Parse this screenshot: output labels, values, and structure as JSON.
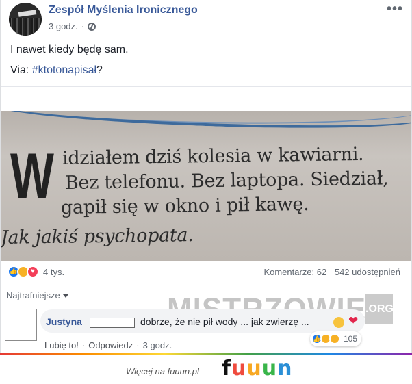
{
  "post": {
    "page_name": "Zespół Myślenia Ironicznego",
    "time": "3 godz.",
    "text_line1": "I nawet kiedy będę sam.",
    "via_label": "Via: ",
    "hashtag": "#ktotonapisał",
    "via_suffix": "?",
    "more_icon": "more-horizontal-icon",
    "privacy_icon": "globe-icon"
  },
  "image_text": {
    "drop_cap": "W",
    "line1": "idziałem dziś kolesia w kawiarni.",
    "line2": "Bez telefonu. Bez laptopa. Siedział,",
    "line3": "gapił się w okno i pił kawę.",
    "line4": "Jak jakiś psychopata."
  },
  "stats": {
    "reactions_count": "4 tys.",
    "comments": "Komentarze: 62",
    "shares": "542 udostępnień"
  },
  "comments_section": {
    "filter_label": "Najtrafniejsze",
    "comment": {
      "author": "Justyna",
      "text": "dobrze, że nie pił wody ... jak zwierzę ...",
      "reaction_count": "105",
      "like_label": "Lubię to!",
      "reply_label": "Odpowiedz",
      "time": "3 godz."
    }
  },
  "watermark": {
    "text": "MISTRZOWIE",
    "suffix": ".ORG"
  },
  "footer": {
    "more_text": "Więcej na fuuun.pl",
    "logo": [
      "f",
      "u",
      "u",
      "u",
      "n"
    ]
  },
  "colors": {
    "link_blue": "#385898",
    "like_blue": "#1877f2",
    "haha_yellow": "#f7b125",
    "love_red": "#f33e58"
  }
}
